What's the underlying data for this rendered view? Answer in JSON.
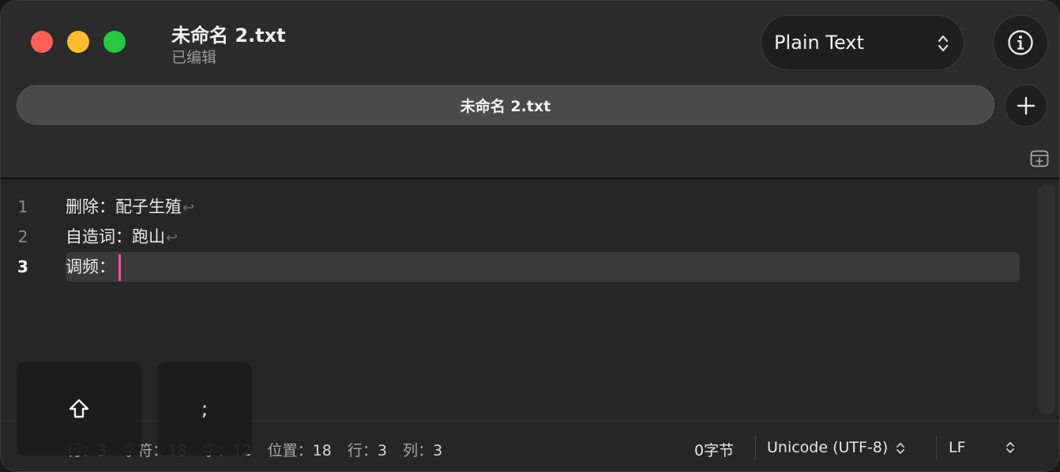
{
  "window": {
    "title": "未命名 2.txt",
    "subtitle": "已编辑"
  },
  "toolbar": {
    "syntax_label": "Plain Text",
    "info_icon": "info-circle-icon",
    "updown_icon": "chevron-updown-icon"
  },
  "tabs": [
    {
      "label": "未命名 2.txt",
      "active": true
    }
  ],
  "tabbar": {
    "add_icon": "plus-icon",
    "new_tab_icon": "new-tab-icon"
  },
  "editor": {
    "lines": [
      {
        "number": "1",
        "text": "删除：配子生殖",
        "return_mark": "↩"
      },
      {
        "number": "2",
        "text": "自造词：跑山",
        "return_mark": "↩"
      },
      {
        "number": "3",
        "text": "调频：",
        "return_mark": ""
      }
    ],
    "current_line": 3,
    "cursor_color": "#ff4f9a"
  },
  "status": {
    "line_label": "行：",
    "line_value": "3",
    "chars_label": "字符：",
    "chars_value": "18",
    "words_label": "字：",
    "words_value": "12",
    "position_label": "位置：",
    "position_value": "18",
    "row_label": "行：",
    "row_value": "3",
    "col_label": "列：",
    "col_value": "3",
    "bytes": "0字节",
    "encoding": "Unicode (UTF-8)",
    "line_ending": "LF"
  },
  "keyboard": {
    "shift_icon": "shift-arrow-icon",
    "shift_glyph": "⇧",
    "semicolon": ";"
  },
  "colors": {
    "close": "#ff5f57",
    "minimize": "#febc2e",
    "zoom": "#28c840",
    "background": "#262626"
  }
}
